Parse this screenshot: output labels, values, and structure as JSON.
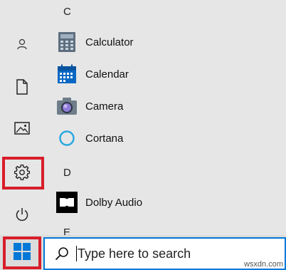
{
  "sidebar": {
    "items": [
      {
        "name": "user-icon"
      },
      {
        "name": "document-icon"
      },
      {
        "name": "pictures-icon"
      },
      {
        "name": "settings-icon"
      },
      {
        "name": "power-icon"
      }
    ],
    "highlight_color": "#d81e2a"
  },
  "applist": {
    "letter_c": "C",
    "letter_d": "D",
    "letter_e": "E",
    "apps": [
      {
        "label": "Calculator",
        "icon": "calculator-icon"
      },
      {
        "label": "Calendar",
        "icon": "calendar-icon"
      },
      {
        "label": "Camera",
        "icon": "camera-icon"
      },
      {
        "label": "Cortana",
        "icon": "cortana-icon"
      },
      {
        "label": "Dolby Audio",
        "icon": "dolby-icon"
      }
    ]
  },
  "taskbar": {
    "start_icon": "windows-logo-icon",
    "search": {
      "placeholder": "Type here to search",
      "icon": "search-icon"
    },
    "accent_color": "#0078d7"
  },
  "watermark": "wsxdn.com"
}
